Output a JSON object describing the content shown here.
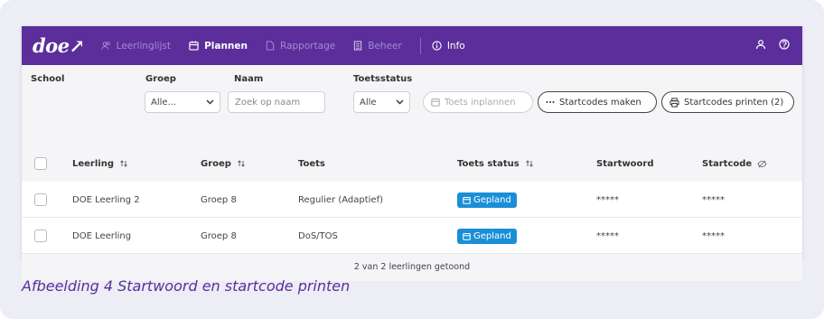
{
  "app": {
    "logo": "doe↗",
    "nav": [
      {
        "label": "Leerlinglijst",
        "icon": "students-icon"
      },
      {
        "label": "Plannen",
        "icon": "calendar-icon"
      },
      {
        "label": "Rapportage",
        "icon": "report-icon"
      },
      {
        "label": "Beheer",
        "icon": "manage-icon"
      },
      {
        "label": "Info",
        "icon": "info-icon"
      }
    ],
    "right_icons": [
      "user-icon",
      "help-icon"
    ]
  },
  "filters": {
    "school_label": "School",
    "groep_label": "Groep",
    "groep_value": "Alle...",
    "naam_label": "Naam",
    "naam_placeholder": "Zoek op naam",
    "toetsstatus_label": "Toetsstatus",
    "toetsstatus_value": "Alle"
  },
  "actions": {
    "toets_inplannen": "Toets inplannen",
    "startcodes_maken": "Startcodes maken",
    "startcodes_printen": "Startcodes printen (2)"
  },
  "table": {
    "headers": {
      "leerling": "Leerling",
      "groep": "Groep",
      "toets": "Toets",
      "toets_status": "Toets status",
      "startwoord": "Startwoord",
      "startcode": "Startcode"
    },
    "rows": [
      {
        "leerling": "DOE Leerling 2",
        "groep": "Groep 8",
        "toets": "Regulier (Adaptief)",
        "status": "Gepland",
        "startwoord": "*****",
        "startcode": "*****"
      },
      {
        "leerling": "DOE Leerling",
        "groep": "Groep 8",
        "toets": "DoS/TOS",
        "status": "Gepland",
        "startwoord": "*****",
        "startcode": "*****"
      }
    ],
    "footer": "2 van 2 leerlingen getoond"
  },
  "caption": "Afbeelding 4 Startwoord en startcode printen",
  "colors": {
    "brand": "#5b2e9b",
    "badge": "#1a8fd6"
  }
}
